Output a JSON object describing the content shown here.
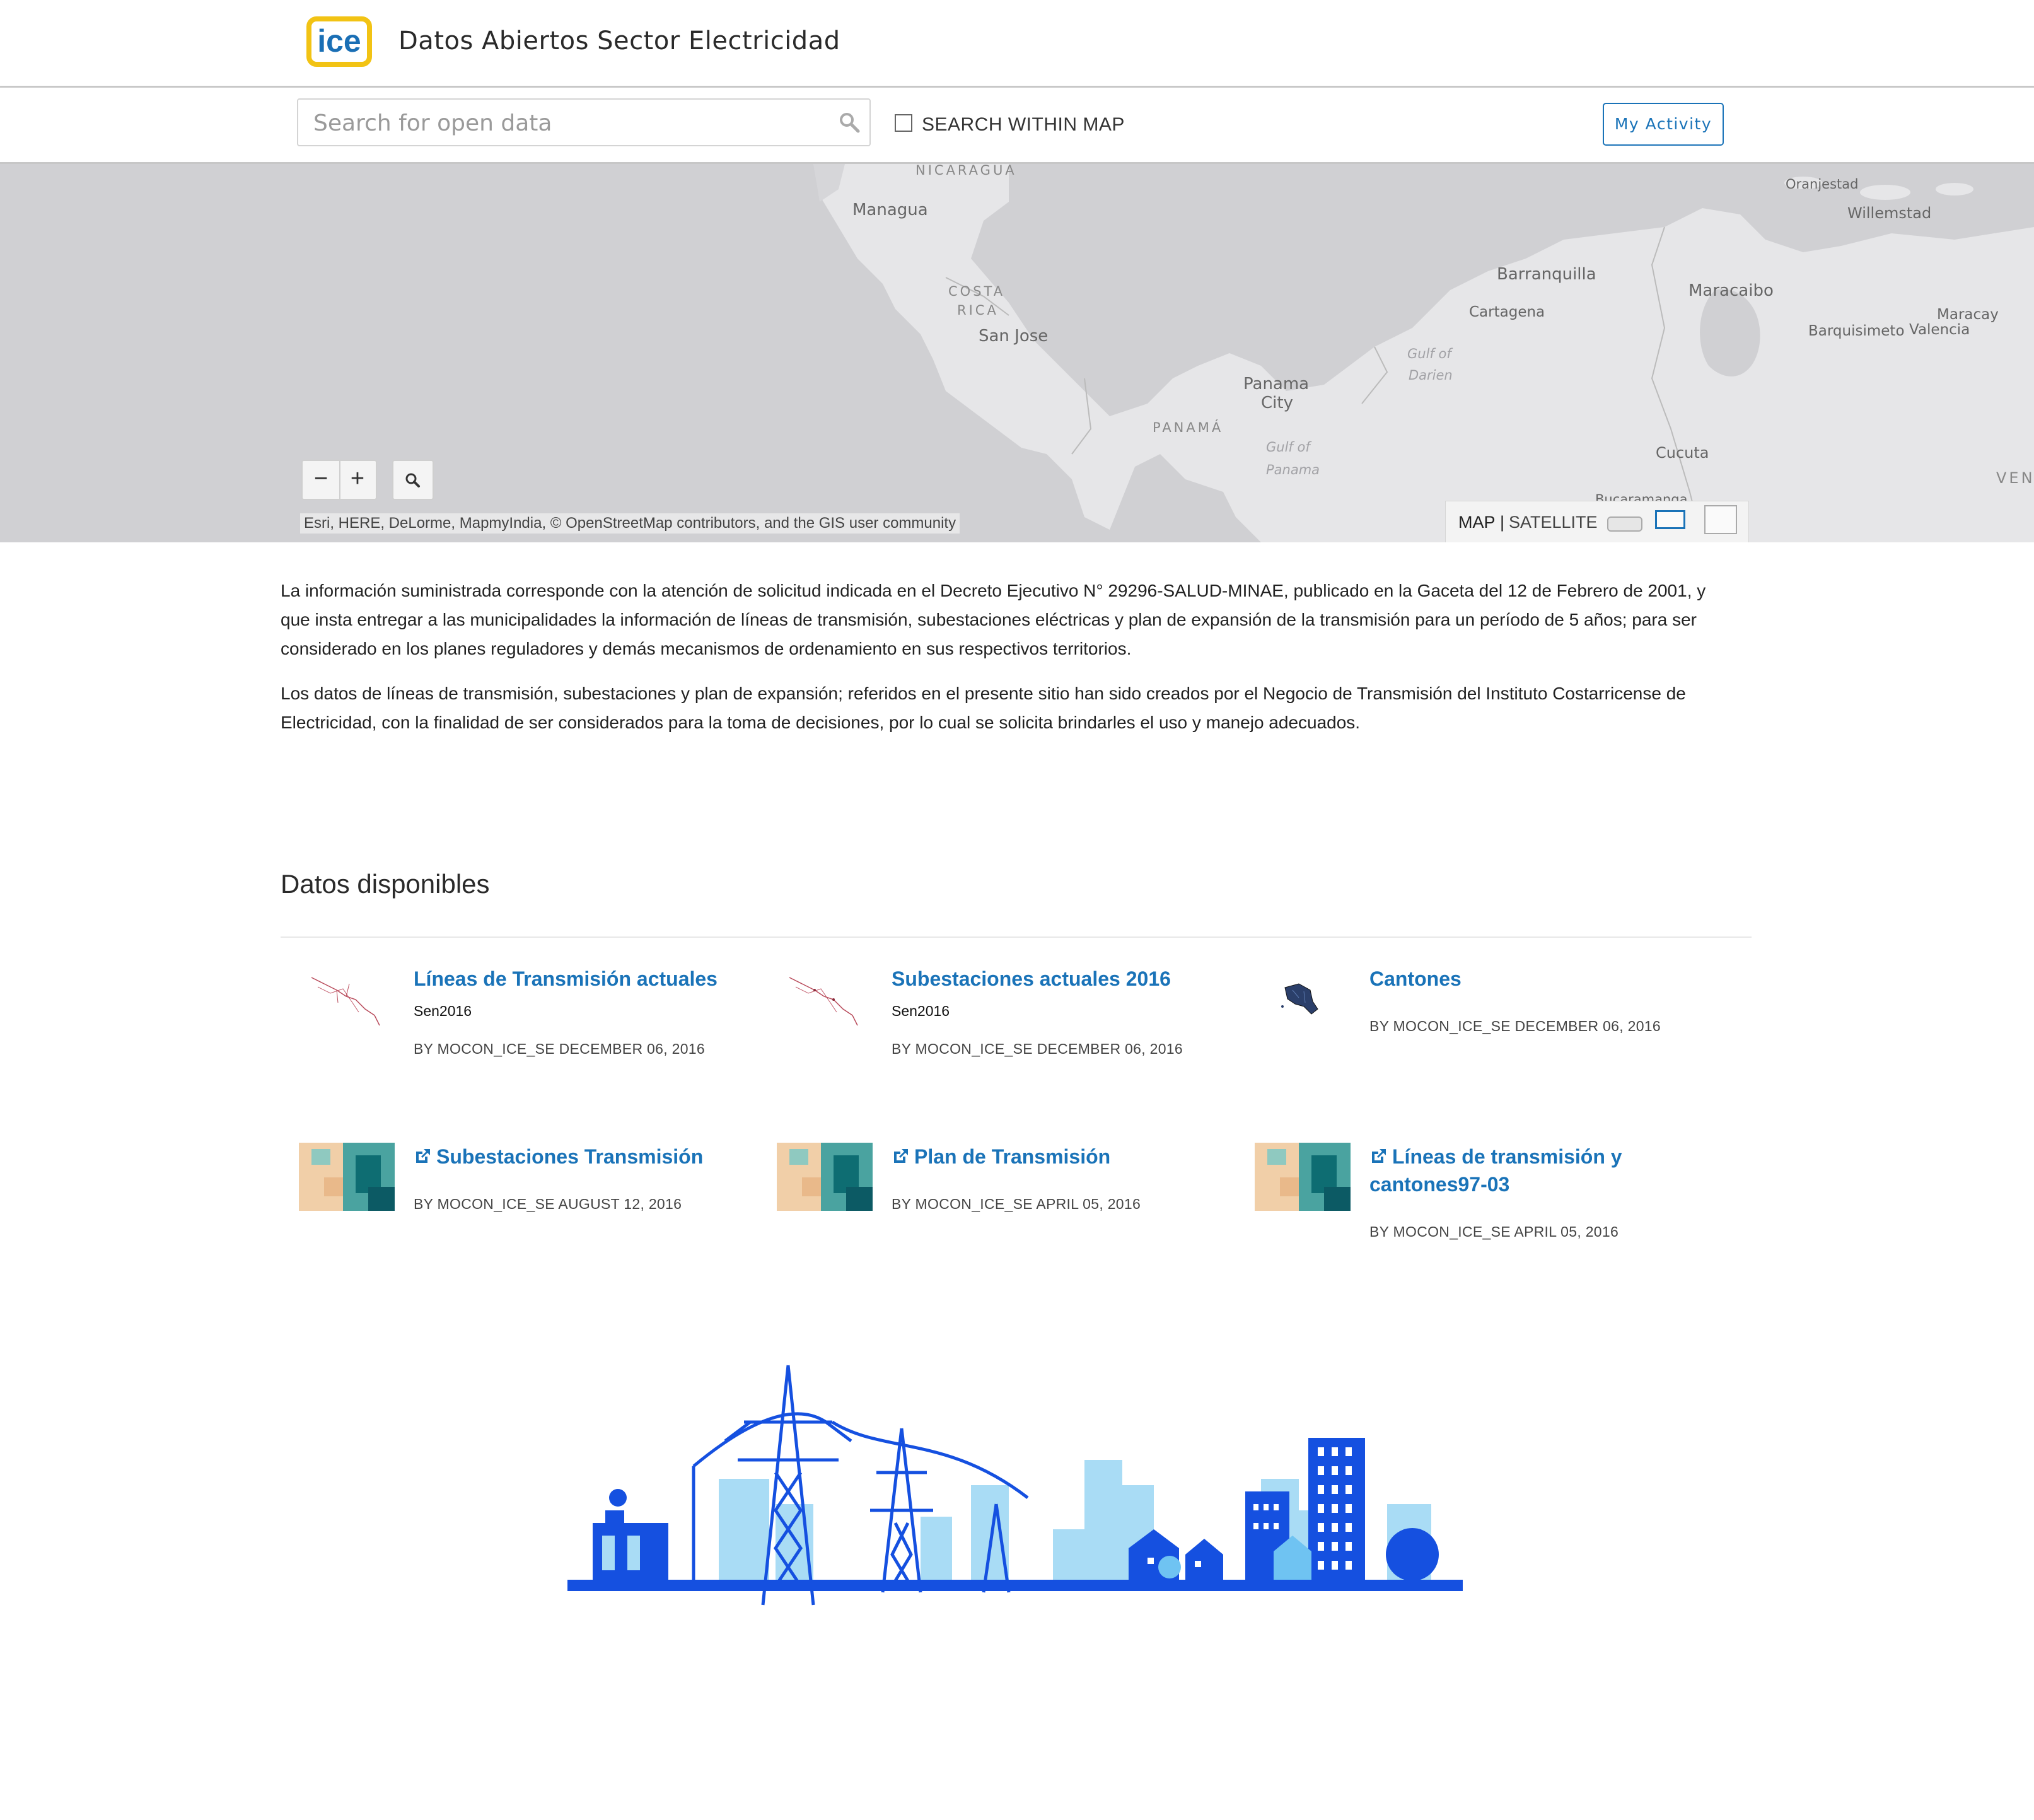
{
  "header": {
    "title": "Datos Abiertos Sector Electricidad",
    "logo_text": "ice"
  },
  "search": {
    "placeholder": "Search for open data",
    "within_map_label": "SEARCH WITHIN MAP",
    "activity_button": "My Activity"
  },
  "map": {
    "labels": {
      "nicaragua": "NICARAGUA",
      "managua": "Managua",
      "costa_rica_1": "COSTA",
      "costa_rica_2": "RICA",
      "san_jose": "San Jose",
      "panama_country": "PANAMÁ",
      "panama_city_1": "Panama",
      "panama_city_2": "City",
      "gulf_darien_1": "Gulf of",
      "gulf_darien_2": "Darien",
      "gulf_panama_1": "Gulf of",
      "gulf_panama_2": "Panama",
      "barranquilla": "Barranquilla",
      "cartagena": "Cartagena",
      "maracaibo": "Maracaibo",
      "oranjestad": "Oranjestad",
      "willemstad": "Willemstad",
      "barquisimeto": "Barquisimeto",
      "valencia": "Valencia",
      "maracay": "Maracay",
      "cucuta": "Cucuta",
      "bucaramanga": "Bucaramanga",
      "ven": "VEN"
    },
    "zoom_out": "−",
    "zoom_in": "+",
    "attribution": "Esri, HERE, DeLorme, MapmyIndia, © OpenStreetMap contributors, and the GIS user community",
    "basemap": {
      "map": "MAP",
      "separator": "|",
      "satellite": "SATELLITE"
    }
  },
  "intro": {
    "p1": "La información suministrada corresponde con la atención de solicitud indicada en el Decreto Ejecutivo N° 29296-SALUD-MINAE, publicado en la Gaceta del 12 de Febrero de 2001, y que insta entregar a las municipalidades la información de líneas de transmisión, subestaciones eléctricas y plan de expansión de la transmisión para un período de 5 años; para ser considerado en los planes reguladores y demás mecanismos de ordenamiento en sus respectivos territorios.",
    "p2": "Los datos de líneas de transmisión, subestaciones y plan de expansión; referidos en el presente sitio han sido creados por el Negocio de Transmisión del Instituto Costarricense de Electricidad, con la finalidad de ser considerados para la toma de decisiones, por lo cual se solicita brindarles el uso y manejo adecuados."
  },
  "datasets": {
    "title": "Datos disponibles",
    "items": [
      {
        "title": "Líneas de Transmisión actuales",
        "subtitle": "Sen2016",
        "meta": "BY MOCON_ICE_SE DECEMBER 06, 2016"
      },
      {
        "title": "Subestaciones actuales 2016",
        "subtitle": "Sen2016",
        "meta": "BY MOCON_ICE_SE DECEMBER 06, 2016"
      },
      {
        "title": "Cantones",
        "meta": "BY MOCON_ICE_SE DECEMBER 06, 2016"
      },
      {
        "title": "Subestaciones Transmisión",
        "meta": "BY MOCON_ICE_SE AUGUST 12, 2016"
      },
      {
        "title": "Plan de Transmisión",
        "meta": "BY MOCON_ICE_SE APRIL 05, 2016"
      },
      {
        "title": "Líneas de transmisión y cantones97-03",
        "meta": "BY MOCON_ICE_SE APRIL 05, 2016"
      }
    ]
  },
  "colors": {
    "accent": "#1a73b8",
    "logo_yellow": "#f2c314",
    "illustration_dark": "#1550e0",
    "illustration_light": "#a9dcf5"
  }
}
